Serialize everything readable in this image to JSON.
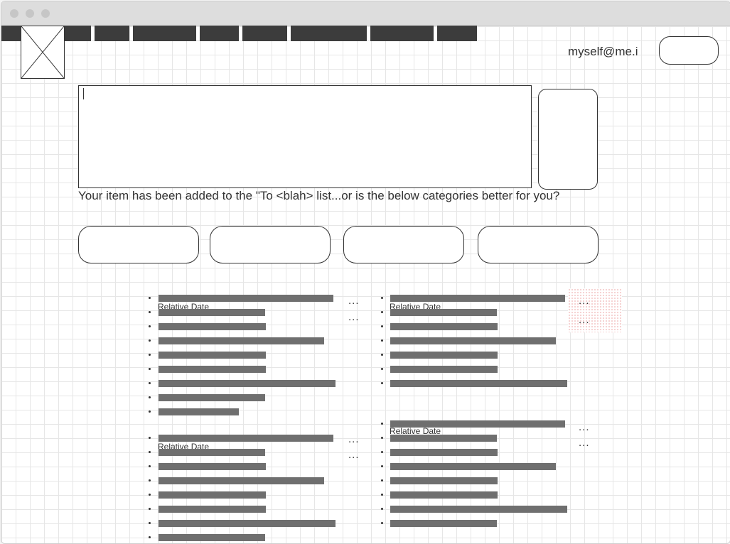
{
  "window": {
    "title": ""
  },
  "header": {
    "logo_icon": "image-placeholder-icon",
    "user_email": "myself@me.i",
    "account_button_label": ""
  },
  "compose": {
    "input_value": "",
    "submit_label": ""
  },
  "message": "Your item has been added to the \"To <blah> list...or is the below categories better for you?",
  "categories": [
    "",
    "",
    "",
    ""
  ],
  "lists": {
    "date_label": "Relative Date",
    "more_label": "..."
  }
}
